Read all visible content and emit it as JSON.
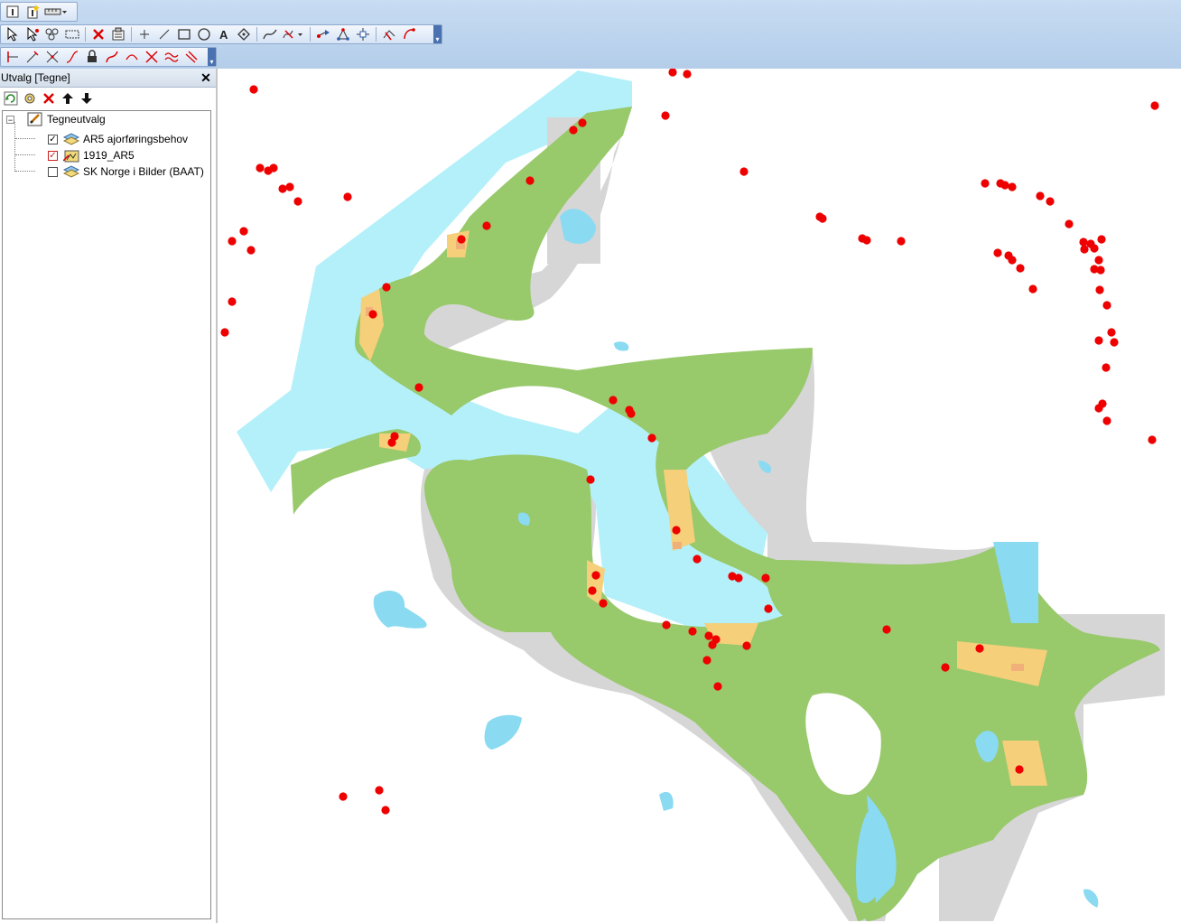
{
  "panel": {
    "title": "Utvalg [Tegne]",
    "close_glyph": "✕",
    "tools": [
      {
        "name": "refresh-selection-button",
        "icon": "refresh-icon"
      },
      {
        "name": "selection-settings-button",
        "icon": "settings-icon"
      },
      {
        "name": "remove-layer-button",
        "icon": "delete-x-icon"
      },
      {
        "name": "move-up-button",
        "icon": "arrow-up-icon"
      },
      {
        "name": "move-down-button",
        "icon": "arrow-down-icon"
      }
    ]
  },
  "tree": {
    "root": {
      "label": "Tegneutvalg",
      "expander": "−"
    },
    "layers": [
      {
        "label": "AR5 ajorføringsbehov",
        "checked": true,
        "check_glyph": "✓",
        "check_color": "#000000"
      },
      {
        "label": "1919_AR5",
        "checked": true,
        "check_glyph": "✓",
        "check_color": "#cc2020"
      },
      {
        "label": "SK Norge i Bilder (BAAT)",
        "checked": false,
        "check_glyph": "",
        "check_color": "#000000"
      }
    ]
  },
  "toolbars": {
    "row1": [
      "info-tool",
      "identify-tool",
      "new-tool",
      "measure-tool"
    ],
    "row2": [
      "select-tool",
      "select-arrow-tool",
      "select-group-tool",
      "select-rect-tool",
      "delete-tool",
      "properties-tool",
      "point-tool",
      "line-tool",
      "rectangle-tool",
      "circle-tool",
      "text-tool",
      "vertex-tool",
      "curve-tool",
      "cut-tool",
      "snap-tool",
      "node-tool",
      "move-node-tool",
      "erase-tool",
      "pen-tool"
    ],
    "row3": [
      "split-tool",
      "extend-tool",
      "trim-tool",
      "fillet-tool",
      "lock-tool",
      "reshape-tool",
      "arc-tool",
      "cross-tool",
      "wave-tool",
      "offset-tool"
    ]
  },
  "map": {
    "colors": {
      "sea": "#b3f0fa",
      "land_forest": "#98c96b",
      "bare_rock": "#d6d6d6",
      "lake": "#8adaf2",
      "agriculture": "#f5cf7a",
      "builtup": "#f1b07a",
      "marker": "#ee0000"
    }
  }
}
